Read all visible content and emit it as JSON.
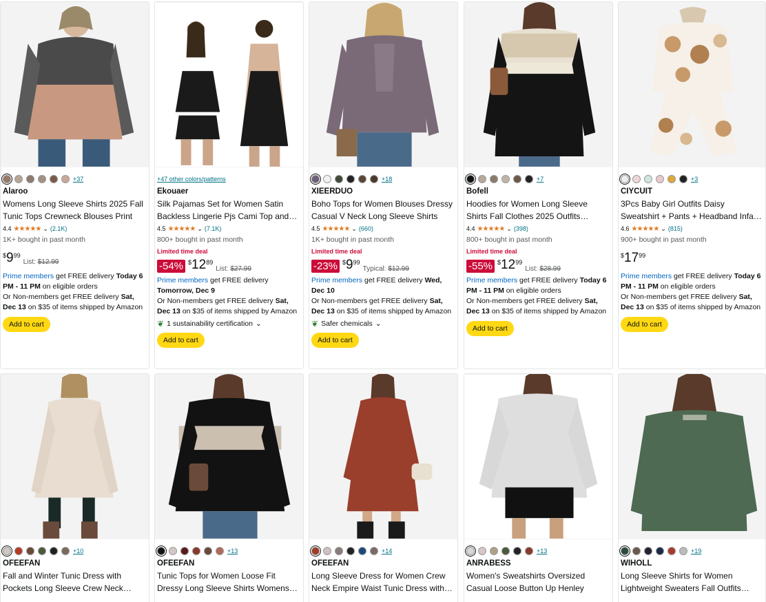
{
  "products": [
    {
      "brand": "Alaroo",
      "title": "Womens Long Sleeve Shirts 2025 Fall Tunic Tops Crewneck Blouses Print",
      "rating": "4.4",
      "count": "(2.1K)",
      "bought": "1K+ bought in past month",
      "deal": "",
      "discount": "",
      "price_whole": "9",
      "price_frac": "99",
      "list_label": "List:",
      "list_price": "$12.99",
      "deliv_prime_label": "Prime members",
      "deliv_prime_rest": "get FREE delivery",
      "deliv_prime_bold": "Today 6 PM - 11 PM",
      "deliv_prime_tail": "on eligible orders",
      "deliv_non": "Or Non-members get FREE delivery",
      "deliv_non_bold": "Sat, Dec 13",
      "deliv_non_tail": "on $35 of items shipped by Amazon",
      "sust": "",
      "cart": "Add to cart",
      "more": "+37",
      "colors_link": "",
      "swatches": [
        "#9a7866",
        "#b8a596",
        "#8c7a6e",
        "#a09182",
        "#7c5a4a",
        "#c9a89c"
      ]
    },
    {
      "brand": "Ekouaer",
      "title": "Silk Pajamas Set for Women Satin Backless Lingerie Pjs Cami Top and…",
      "rating": "4.5",
      "count": "(7.1K)",
      "bought": "800+ bought in past month",
      "deal": "Limited time deal",
      "discount": "-54%",
      "price_whole": "12",
      "price_frac": "89",
      "list_label": "List:",
      "list_price": "$27.99",
      "deliv_prime_label": "Prime members",
      "deliv_prime_rest": "get FREE delivery",
      "deliv_prime_bold": "Tomorrow, Dec 9",
      "deliv_prime_tail": "",
      "deliv_non": "Or Non-members get FREE delivery",
      "deliv_non_bold": "Sat, Dec 13",
      "deliv_non_tail": "on $35 of items shipped by Amazon",
      "sust": "1 sustainability certification",
      "cart": "Add to cart",
      "more": "",
      "colors_link": "+47 other colors/patterns",
      "swatches": []
    },
    {
      "brand": "XIEERDUO",
      "title": "Boho Tops for Women Blouses Dressy Casual V Neck Long Sleeve Shirts Fa…",
      "rating": "4.5",
      "count": "(660)",
      "bought": "1K+ bought in past month",
      "deal": "Limited time deal",
      "discount": "-23%",
      "price_whole": "9",
      "price_frac": "99",
      "list_label": "Typical:",
      "list_price": "$12.99",
      "deliv_prime_label": "Prime members",
      "deliv_prime_rest": "get FREE delivery",
      "deliv_prime_bold": "Wed, Dec 10",
      "deliv_prime_tail": "",
      "deliv_non": "Or Non-members get FREE delivery",
      "deliv_non_bold": "Sat, Dec 13",
      "deliv_non_tail": "on $35 of items shipped by Amazon",
      "sust": "Safer chemicals",
      "cart": "Add to cart",
      "more": "+18",
      "colors_link": "",
      "swatches": [
        "#6e5e76",
        "#f1f1f1",
        "#3d4a3a",
        "#222222",
        "#5a4636",
        "#4a3a2a"
      ]
    },
    {
      "brand": "Bofell",
      "title": "Hoodies for Women Long Sleeve Shirts Fall Clothes 2025 Outfits…",
      "rating": "4.4",
      "count": "(398)",
      "bought": "800+ bought in past month",
      "deal": "Limited time deal",
      "discount": "-55%",
      "price_whole": "12",
      "price_frac": "99",
      "list_label": "List:",
      "list_price": "$28.99",
      "deliv_prime_label": "Prime members",
      "deliv_prime_rest": "get FREE delivery",
      "deliv_prime_bold": "Today 6 PM - 11 PM",
      "deliv_prime_tail": "on eligible orders",
      "deliv_non": "Or Non-members get FREE delivery",
      "deliv_non_bold": "Sat, Dec 13",
      "deliv_non_tail": "on $35 of items shipped by Amazon",
      "sust": "",
      "cart": "Add to cart",
      "more": "+7",
      "colors_link": "",
      "swatches": [
        "#111111",
        "#b5a89a",
        "#8a7a6a",
        "#c0b4a8",
        "#6a5a4a",
        "#222222"
      ]
    },
    {
      "brand": "CIYCUIT",
      "title": "3Pcs Baby Girl Outfits Daisy Sweatshirt + Pants + Headband Infa…",
      "rating": "4.6",
      "count": "(815)",
      "bought": "900+ bought in past month",
      "deal": "",
      "discount": "",
      "price_whole": "17",
      "price_frac": "99",
      "list_label": "",
      "list_price": "",
      "deliv_prime_label": "Prime members",
      "deliv_prime_rest": "get FREE delivery",
      "deliv_prime_bold": "Today 6 PM - 11 PM",
      "deliv_prime_tail": "on eligible orders",
      "deliv_non": "Or Non-members get FREE delivery",
      "deliv_non_bold": "Sat, Dec 13",
      "deliv_non_tail": "on $35 of items shipped by Amazon",
      "sust": "",
      "cart": "Add to cart",
      "more": "+3",
      "colors_link": "",
      "swatches": [
        "#eeeeee",
        "#f0d6d6",
        "#cfe6e0",
        "#e8c9cf",
        "#e0a93a",
        "#222222"
      ]
    },
    {
      "brand": "OFEEFAN",
      "title": "Fall and Winter Tunic Dress with Pockets Long Sleeve Crew Neck…",
      "more": "+10",
      "colors_link": "",
      "swatches": [
        "#cfc8c0",
        "#b53a24",
        "#6a4a36",
        "#4a5a3a",
        "#222222",
        "#7a6a5a"
      ]
    },
    {
      "brand": "OFEEFAN",
      "title": "Tunic Tops for Women Loose Fit Dressy Long Sleeve Shirts Womens…",
      "more": "+13",
      "colors_link": "",
      "swatches": [
        "#111111",
        "#d6c6c6",
        "#5a1a1a",
        "#8a3a2a",
        "#6a4a3a",
        "#b06a5a"
      ]
    },
    {
      "brand": "OFEEFAN",
      "title": "Long Sleeve Dress for Women Crew Neck Empire Waist Tunic Dress with…",
      "more": "+14",
      "colors_link": "",
      "swatches": [
        "#a53a24",
        "#d0c0c0",
        "#8a7a7a",
        "#222222",
        "#1a4a7a",
        "#7a6a6a"
      ]
    },
    {
      "brand": "ANRABESS",
      "title": "Women's Sweatshirts Oversized Casual Loose Button Up Henley Pullover To…",
      "more": "+13",
      "colors_link": "",
      "swatches": [
        "#d8d8d8",
        "#d6c6c6",
        "#b0a08a",
        "#4a5a3a",
        "#222222",
        "#8a3a2a"
      ]
    },
    {
      "brand": "WIHOLL",
      "title": "Long Sleeve Shirts for Women Lightweight Sweaters Fall Outfits…",
      "more": "+19",
      "colors_link": "",
      "swatches": [
        "#2a4a3a",
        "#6a5a4a",
        "#222233",
        "#1a2a4a",
        "#a83a2a",
        "#bbbbbb"
      ]
    }
  ],
  "icons": {
    "star": "★",
    "chevron": "⌄",
    "leaf": "❦"
  }
}
